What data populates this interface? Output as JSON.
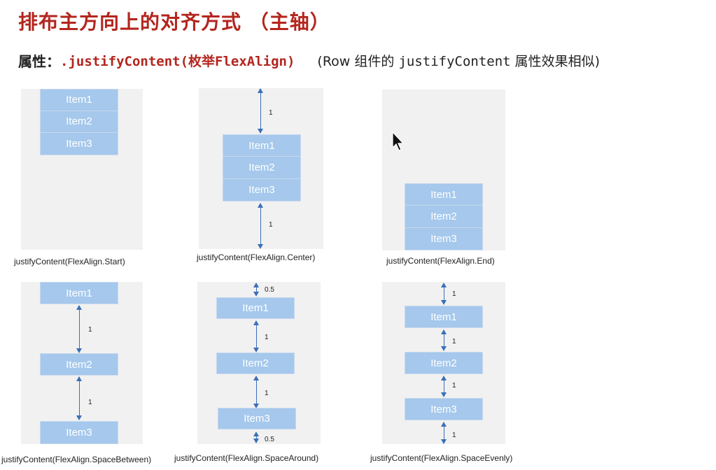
{
  "slide": {
    "title": "排布主方向上的对齐方式 （主轴）",
    "property_label": "属性：",
    "property_code": ".justifyContent(枚举FlexAlign)",
    "note_prefix": "(Row 组件的 ",
    "note_code": "justifyContent",
    "note_suffix": " 属性效果相似)"
  },
  "items": [
    "Item1",
    "Item2",
    "Item3"
  ],
  "gap_labels": {
    "one": "1",
    "half": "0.5"
  },
  "examples": [
    {
      "caption": "justifyContent(FlexAlign.Start)"
    },
    {
      "caption": "justifyContent(FlexAlign.Center)"
    },
    {
      "caption": "justifyContent(FlexAlign.End)"
    },
    {
      "caption": "justifyContent(FlexAlign.SpaceBetween)"
    },
    {
      "caption": "justifyContent(FlexAlign.SpaceAround)"
    },
    {
      "caption": "justifyContent(FlexAlign.SpaceEvenly)"
    }
  ]
}
